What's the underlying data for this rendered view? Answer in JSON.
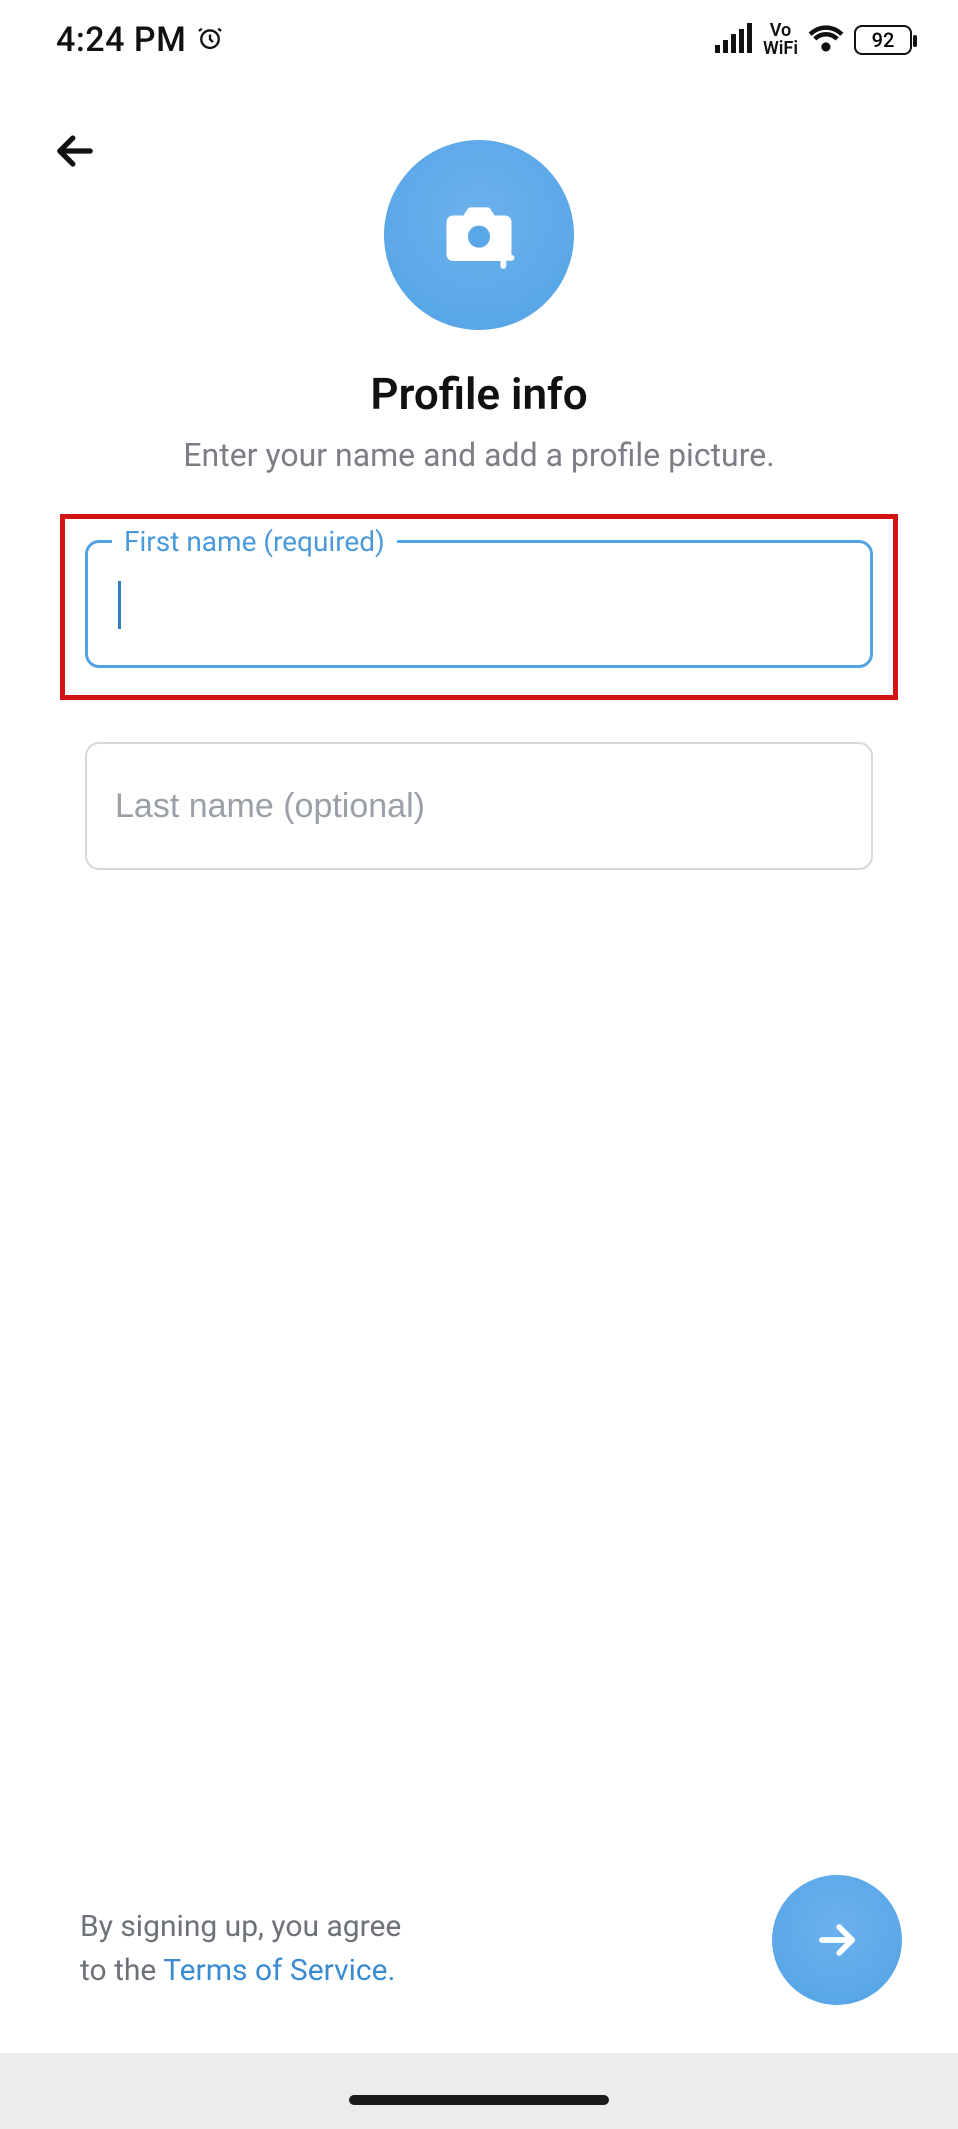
{
  "status": {
    "time": "4:24 PM",
    "battery": "92",
    "alarm_icon": "alarm",
    "vowifi_top": "Vo",
    "vowifi_bottom": "WiFi"
  },
  "header": {
    "title": "Profile info",
    "subtitle": "Enter your name and add a profile picture."
  },
  "fields": {
    "first_name_label": "First name (required)",
    "first_name_value": "",
    "last_name_placeholder": "Last name (optional)",
    "last_name_value": ""
  },
  "footer": {
    "agree_line1": "By signing up, you agree",
    "agree_line2_pre": "to the ",
    "tos": "Terms of Service.",
    "tos_link_text": "Terms of Service."
  },
  "colors": {
    "accent": "#55a3e7",
    "highlight_border": "#d11313",
    "muted_text": "#7b7f85"
  }
}
